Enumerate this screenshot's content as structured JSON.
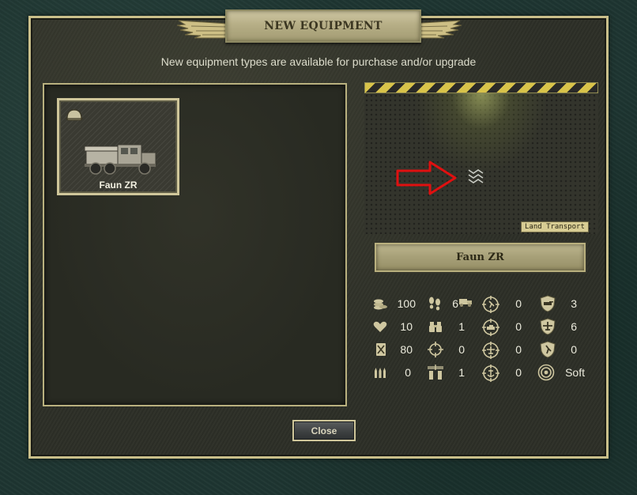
{
  "dialog": {
    "title": "NEW EQUIPMENT",
    "subtitle": "New equipment types are available for purchase and/or upgrade",
    "close_label": "Close"
  },
  "units": [
    {
      "name": "Faun ZR",
      "class_icon": "helmet-icon"
    }
  ],
  "selected": {
    "name": "Faun ZR",
    "class_label": "Land Transport"
  },
  "stats": [
    {
      "icon": "coins-icon",
      "value": "100"
    },
    {
      "icon": "footprints-icon",
      "value": "6"
    },
    {
      "icon": "truck-movement-icon",
      "value": ""
    },
    {
      "icon": "soft-target-attack-icon",
      "value": "0"
    },
    {
      "icon": "ground-defense-shield-icon",
      "value": "3"
    },
    {
      "icon": "heart-icon",
      "value": "10"
    },
    {
      "icon": "binoculars-icon",
      "value": "1"
    },
    {
      "icon": "hard-target-attack-icon",
      "value": "0"
    },
    {
      "icon": "air-defense-shield-icon",
      "value": "6"
    },
    {
      "icon": "fuel-icon",
      "value": "80"
    },
    {
      "icon": "crosshair-range-icon",
      "value": "0"
    },
    {
      "icon": "air-attack-icon",
      "value": "0"
    },
    {
      "icon": "close-defense-shield-icon",
      "value": "0"
    },
    {
      "icon": "ammo-icon",
      "value": "0"
    },
    {
      "icon": "initiative-icon",
      "value": "1"
    },
    {
      "icon": "naval-attack-icon",
      "value": "0"
    },
    {
      "icon": "target-type-icon",
      "value": "Soft"
    }
  ],
  "colors": {
    "accent": "#c9bf8a",
    "hazard_yellow": "#d8c34a",
    "arrow_red": "#e01010"
  }
}
